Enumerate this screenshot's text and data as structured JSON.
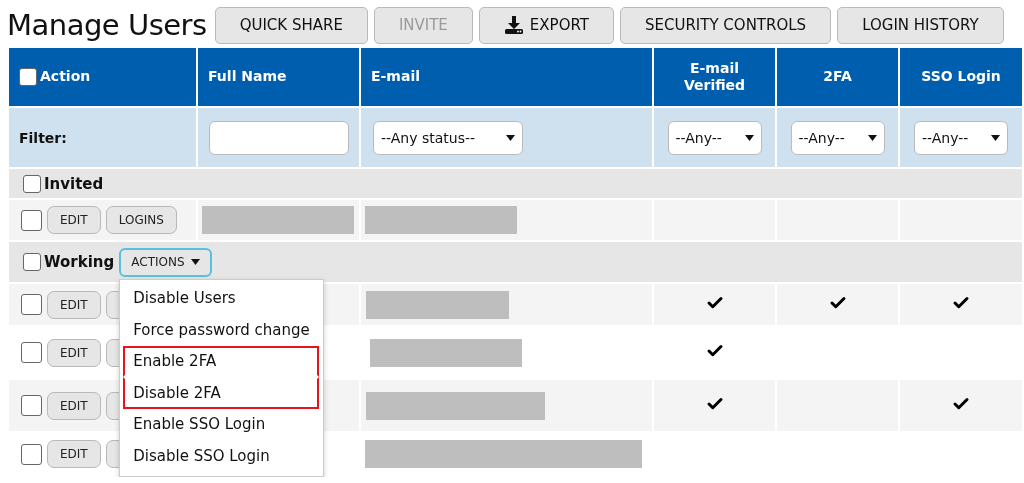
{
  "title": "Manage Users",
  "toolbar": [
    {
      "label": "QUICK SHARE",
      "disabled": false,
      "kind": "plain"
    },
    {
      "label": "INVITE",
      "disabled": true,
      "kind": "plain"
    },
    {
      "label": "EXPORT",
      "disabled": false,
      "kind": "download"
    },
    {
      "label": "SECURITY CONTROLS",
      "disabled": false,
      "kind": "plain"
    },
    {
      "label": "LOGIN HISTORY",
      "disabled": false,
      "kind": "plain"
    }
  ],
  "table": {
    "select_all": {
      "label": "Action",
      "checked": false
    },
    "columns": [
      "Full Name",
      "E-mail",
      "E-mail Verified",
      "2FA",
      "SSO Login"
    ],
    "filter": {
      "label": "Filter:",
      "email_status": "--Any status--",
      "email_verified": "--Any--",
      "two_fa": "--Any--",
      "sso_login": "--Any--"
    },
    "groups": [
      {
        "name": "Invited",
        "checked": false,
        "rows": [
          {
            "checked": false,
            "buttons": [
              "EDIT",
              "LOGINS"
            ],
            "name_redacted": true,
            "email_redacted": true,
            "email_verified": false,
            "two_fa": false,
            "sso_login": false
          }
        ]
      },
      {
        "name": "Working",
        "checked": false,
        "actions": {
          "label": "ACTIONS",
          "expanded": true,
          "items": [
            {
              "label": "Disable Users",
              "highlighted": false
            },
            {
              "label": "Force password change",
              "highlighted": false
            },
            {
              "label": "Enable 2FA",
              "highlighted": true
            },
            {
              "label": "Disable 2FA",
              "highlighted": true
            },
            {
              "label": "Enable SSO Login",
              "highlighted": false
            },
            {
              "label": "Disable SSO Login",
              "highlighted": false
            }
          ]
        },
        "rows": [
          {
            "checked": false,
            "buttons": [
              "EDIT"
            ],
            "name_redacted": false,
            "email_redacted": true,
            "email_verified": true,
            "two_fa": true,
            "sso_login": true
          },
          {
            "checked": false,
            "buttons": [
              "EDIT"
            ],
            "name_redacted": false,
            "email_redacted": true,
            "email_verified": true,
            "two_fa": false,
            "sso_login": false
          },
          {
            "checked": false,
            "buttons": [
              "EDIT"
            ],
            "name_redacted": false,
            "email_redacted": true,
            "email_verified": true,
            "two_fa": false,
            "sso_login": true
          },
          {
            "checked": false,
            "buttons": [
              "EDIT"
            ],
            "name_redacted": false,
            "email_redacted": true,
            "email_verified": false,
            "two_fa": false,
            "sso_login": false
          }
        ]
      }
    ]
  }
}
